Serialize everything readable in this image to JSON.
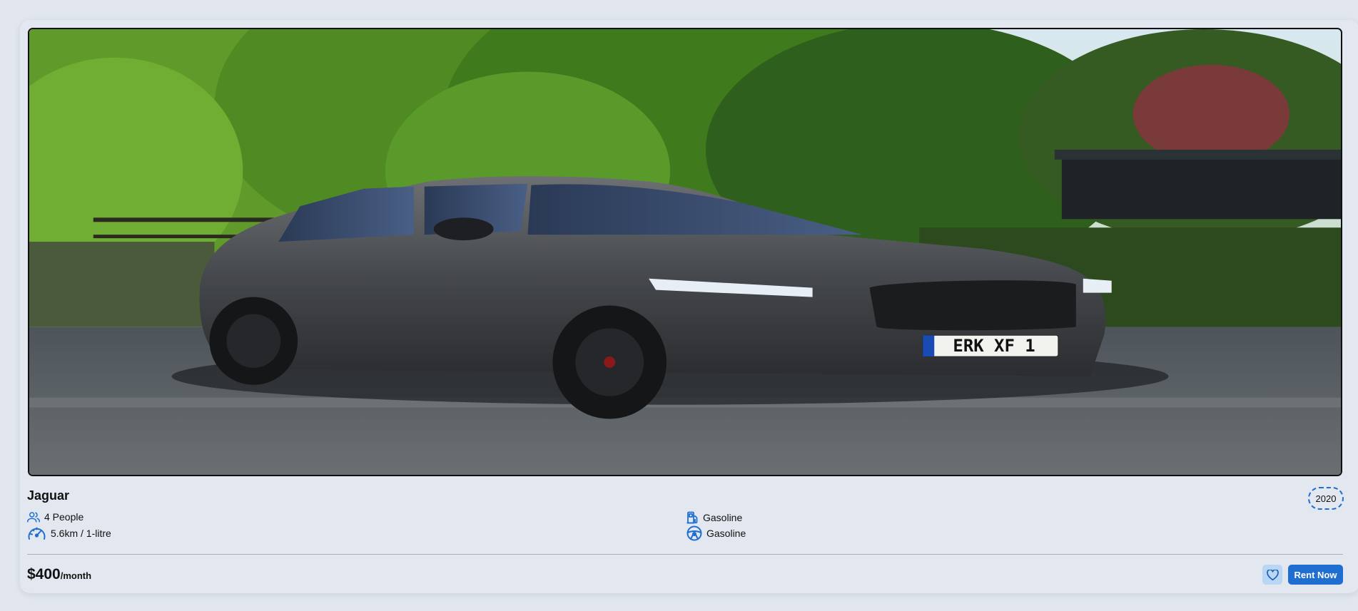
{
  "card": {
    "title": "Jaguar",
    "year": "2020",
    "photo": {
      "subject": "car-photo",
      "plate_text": "ERK XF 1"
    },
    "specs": [
      {
        "icon": "people-icon",
        "label": "4 People"
      },
      {
        "icon": "speedometer-icon",
        "label": "5.6km / 1-litre"
      },
      {
        "icon": "fuel-pump-icon",
        "label": "Gasoline"
      },
      {
        "icon": "steering-wheel-icon",
        "label": "Gasoline"
      }
    ],
    "price": {
      "amount": "$400",
      "period": "/month"
    },
    "actions": {
      "favorite_icon": "heart-icon",
      "rent_label": "Rent Now"
    }
  },
  "colors": {
    "accent": "#1f6fd1",
    "accent_light": "#b9d6f5",
    "background": "#e2e7ef"
  }
}
